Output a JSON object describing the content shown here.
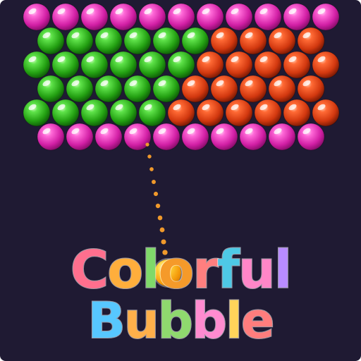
{
  "title": {
    "line1": [
      "C",
      "o",
      "l",
      "o",
      "r",
      "f",
      "u",
      "l"
    ],
    "line2": [
      "B",
      "u",
      "b",
      "b",
      "l",
      "e"
    ],
    "line1_colors": [
      "#ff6f8e",
      "#ffae3c",
      "#7fd96a",
      "#f59a2a",
      "#ff7f7f",
      "#4ec9e6",
      "#ff86c8",
      "#b88cff"
    ],
    "line2_colors": [
      "#57c7ff",
      "#ffb04a",
      "#8fd96e",
      "#ff8bd0",
      "#ffd45a",
      "#ff7d7d"
    ]
  },
  "colors": {
    "background": "#1f1a33",
    "pink": "#e93bb8",
    "green": "#2faa1e",
    "red": "#d9421a",
    "aim_dots": "#f0992b",
    "shooter": "#f5a514"
  },
  "bubble_grid": {
    "rows": [
      [
        "pink",
        "pink",
        "pink",
        "pink",
        "pink",
        "pink",
        "pink",
        "pink",
        "pink",
        "pink",
        "pink"
      ],
      [
        "green",
        "green",
        "green",
        "green",
        "green",
        "green",
        "red",
        "red",
        "red",
        "red"
      ],
      [
        "green",
        "green",
        "green",
        "green",
        "green",
        "green",
        "red",
        "red",
        "red",
        "red",
        "red"
      ],
      [
        "green",
        "green",
        "green",
        "green",
        "green",
        "red",
        "red",
        "red",
        "red",
        "red"
      ],
      [
        "green",
        "green",
        "green",
        "green",
        "green",
        "red",
        "red",
        "red",
        "red",
        "red",
        "red"
      ],
      [
        "pink",
        "pink",
        "pink",
        "pink",
        "pink",
        "pink",
        "pink",
        "pink",
        "pink",
        "pink"
      ]
    ]
  },
  "shooter": {
    "color": "orange"
  }
}
